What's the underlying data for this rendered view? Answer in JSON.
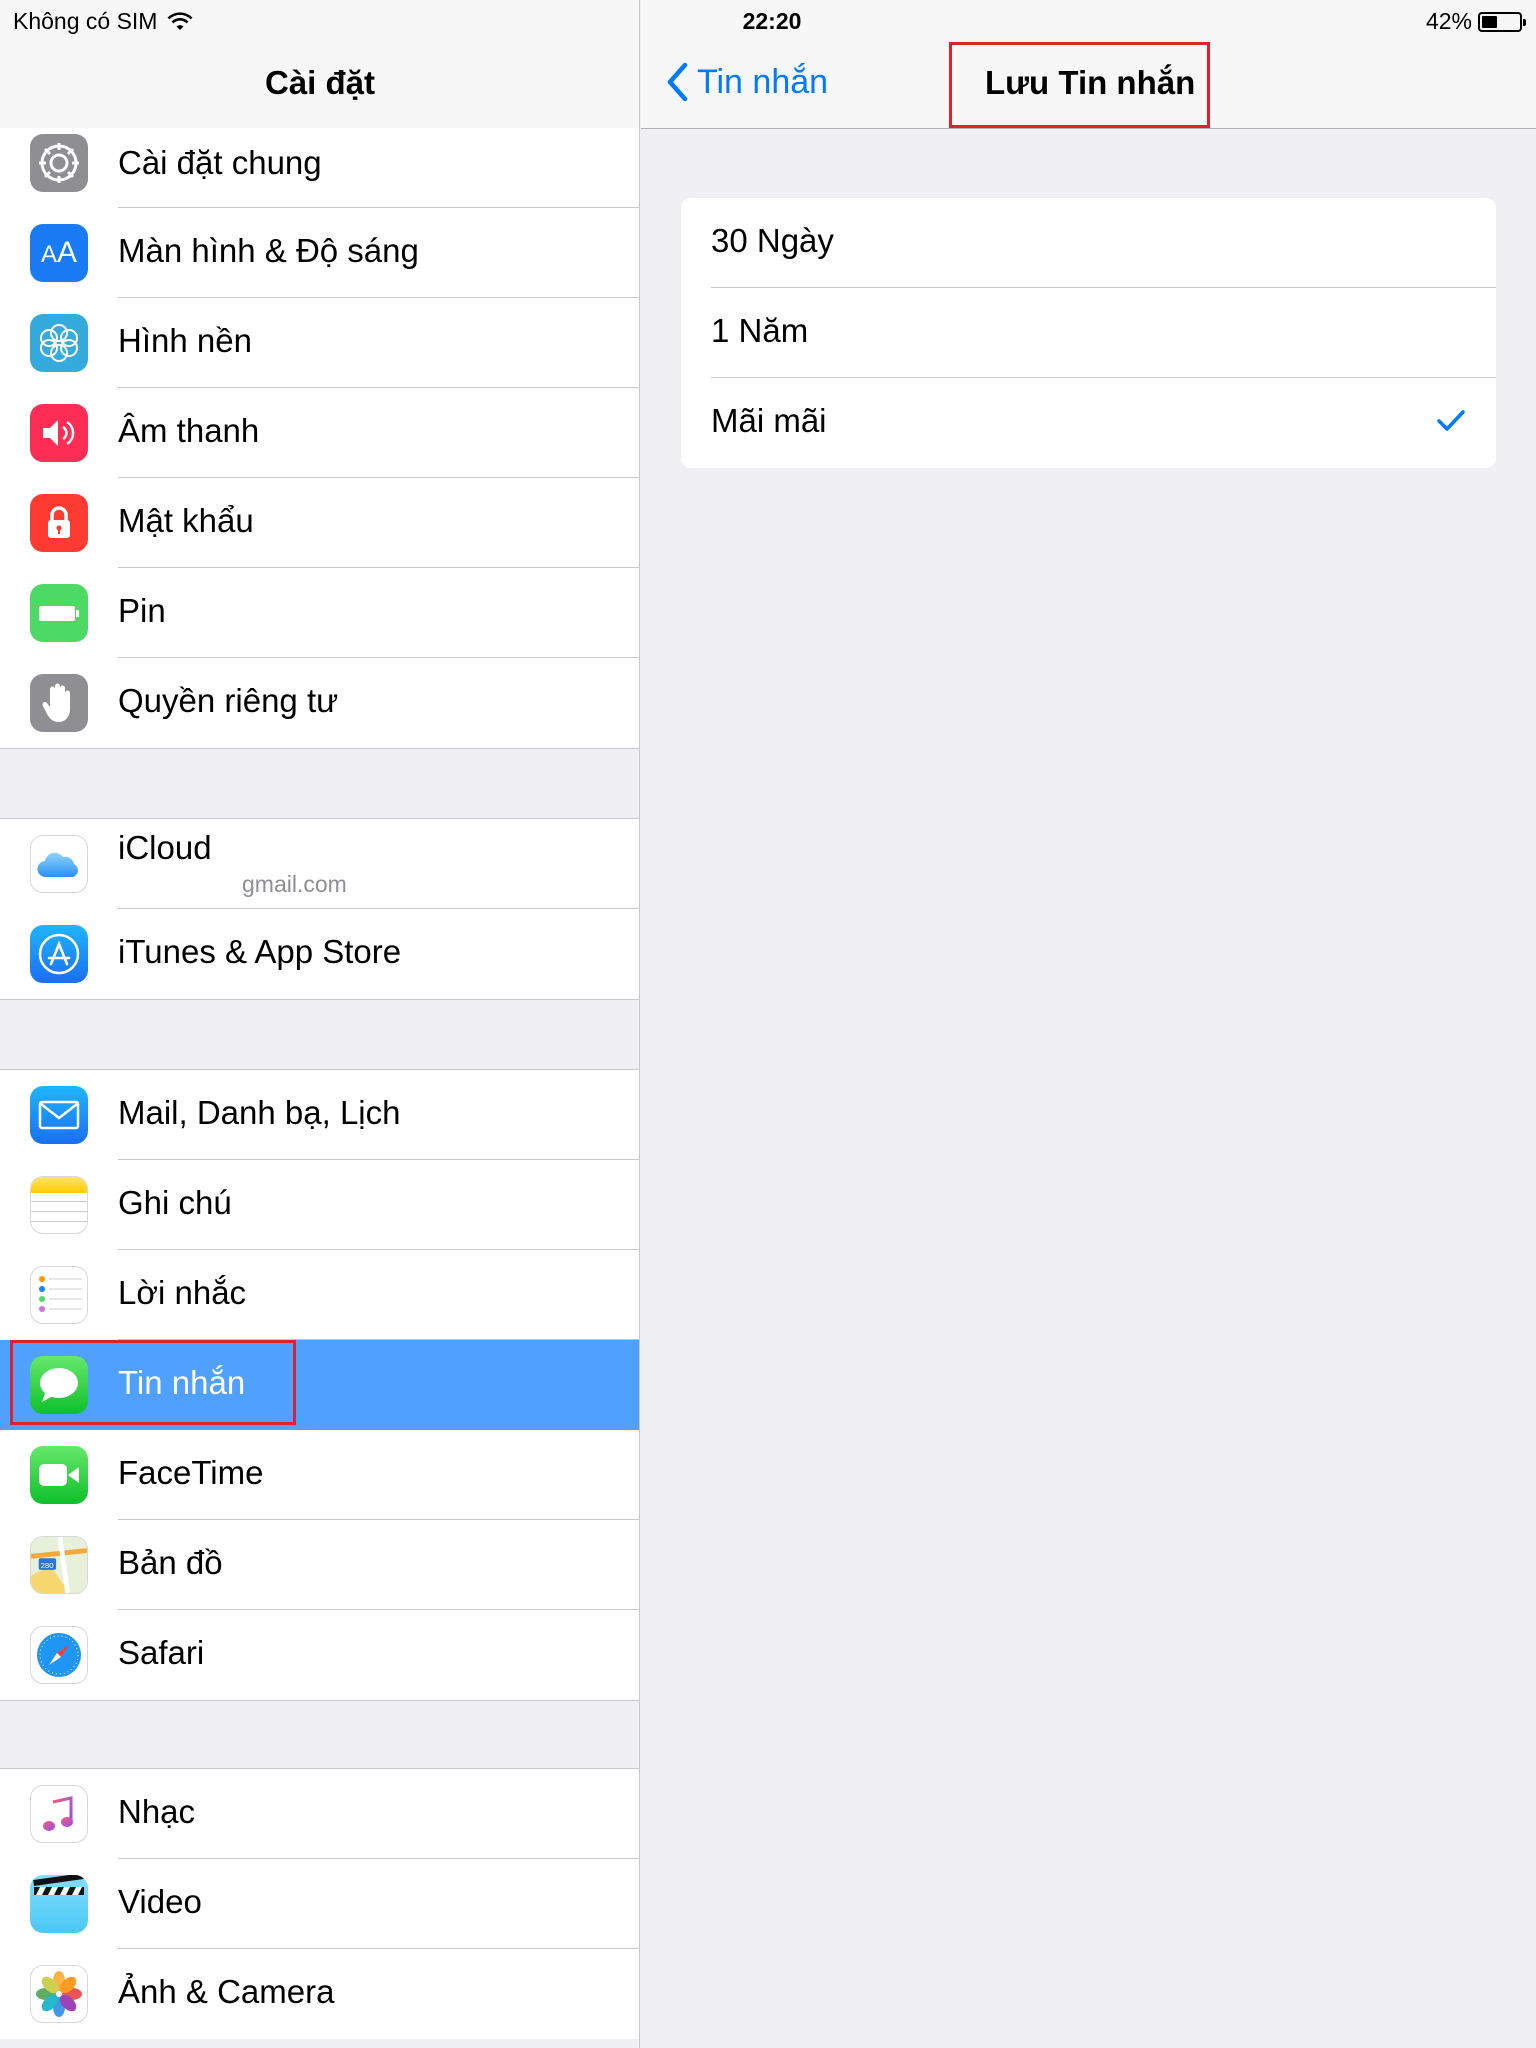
{
  "status_bar": {
    "carrier": "Không có SIM",
    "time": "22:20",
    "battery_percent": "42%",
    "battery_level": 0.42
  },
  "left": {
    "title": "Cài đặt",
    "groups": [
      [
        {
          "label": "Cài đặt chung",
          "icon": "gear-icon",
          "color": "#8e8e93"
        },
        {
          "label": "Màn hình & Độ sáng",
          "icon": "display-brightness-icon",
          "color": "#1a7cf5"
        },
        {
          "label": "Hình nền",
          "icon": "wallpaper-icon",
          "color": "#35aadc"
        },
        {
          "label": "Âm thanh",
          "icon": "speaker-icon",
          "color": "#fe2d55"
        },
        {
          "label": "Mật khẩu",
          "icon": "lock-icon",
          "color": "#fe3b30"
        },
        {
          "label": "Pin",
          "icon": "battery-icon",
          "color": "#4cd964"
        },
        {
          "label": "Quyền riêng tư",
          "icon": "hand-icon",
          "color": "#8e8e93"
        }
      ],
      [
        {
          "label": "iCloud",
          "sublabel": "gmail.com",
          "icon": "cloud-icon",
          "color": "#ffffff"
        },
        {
          "label": "iTunes & App Store",
          "icon": "app-store-icon",
          "color": "#1e8cf7"
        }
      ],
      [
        {
          "label": "Mail, Danh bạ, Lịch",
          "icon": "mail-icon",
          "color": "#1a82fb"
        },
        {
          "label": "Ghi chú",
          "icon": "notes-icon",
          "color": "#ffffff"
        },
        {
          "label": "Lời nhắc",
          "icon": "reminders-icon",
          "color": "#ffffff"
        },
        {
          "label": "Tin nhắn",
          "icon": "messages-icon",
          "color": "#4cd964",
          "selected": true
        },
        {
          "label": "FaceTime",
          "icon": "facetime-icon",
          "color": "#4cd964"
        },
        {
          "label": "Bản đồ",
          "icon": "maps-icon",
          "color": "#ffffff"
        },
        {
          "label": "Safari",
          "icon": "safari-icon",
          "color": "#ffffff"
        }
      ],
      [
        {
          "label": "Nhạc",
          "icon": "music-icon",
          "color": "#ffffff"
        },
        {
          "label": "Video",
          "icon": "video-icon",
          "color": "#5ac8fa"
        },
        {
          "label": "Ảnh & Camera",
          "icon": "photos-icon",
          "color": "#ffffff"
        }
      ]
    ]
  },
  "right": {
    "back_label": "Tin nhắn",
    "title": "Lưu Tin nhắn",
    "options": [
      {
        "label": "30 Ngày",
        "checked": false
      },
      {
        "label": "1 Năm",
        "checked": false
      },
      {
        "label": "Mãi mãi",
        "checked": true
      }
    ]
  },
  "colors": {
    "accent": "#007aff",
    "selected_row": "#4fa0ff",
    "highlight_box": "#e0202d"
  }
}
